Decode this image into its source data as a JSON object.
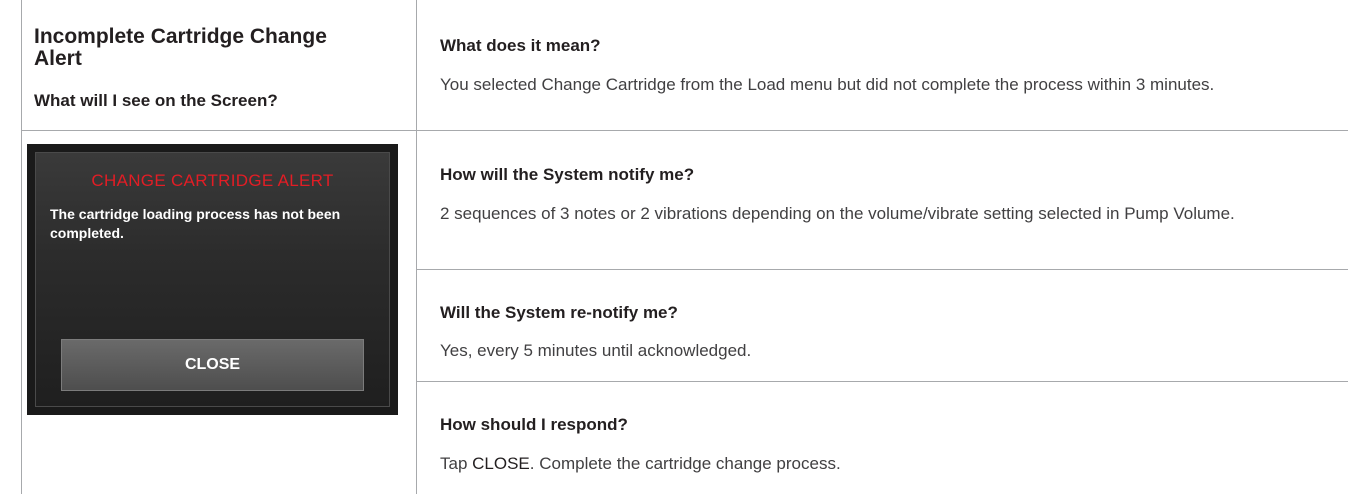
{
  "left_panel": {
    "title": "Incomplete Cartridge Change Alert",
    "screen_question": "What will I see on the Screen?",
    "device_screen": {
      "heading": "CHANGE CARTRIDGE ALERT",
      "message": "The cartridge loading process has not been completed.",
      "button_label": "CLOSE"
    }
  },
  "sections": [
    {
      "question": "What does it mean?",
      "answer": "You selected Change Cartridge from the Load menu but did not complete the process within 3 minutes."
    },
    {
      "question": "How will the System notify me?",
      "answer": "2 sequences of 3 notes or 2 vibrations depending on the volume/vibrate setting selected in Pump Volume."
    },
    {
      "question": "Will the System re-notify me?",
      "answer": "Yes, every 5 minutes until acknowledged."
    },
    {
      "question": "How should I respond?",
      "answer_prefix": "Tap ",
      "answer_emphasis": "CLOSE",
      "answer_suffix": ". Complete the cartridge change process."
    }
  ],
  "colors": {
    "alert_red": "#e21d25",
    "divider": "#a7a9ac",
    "text": "#231f20"
  }
}
